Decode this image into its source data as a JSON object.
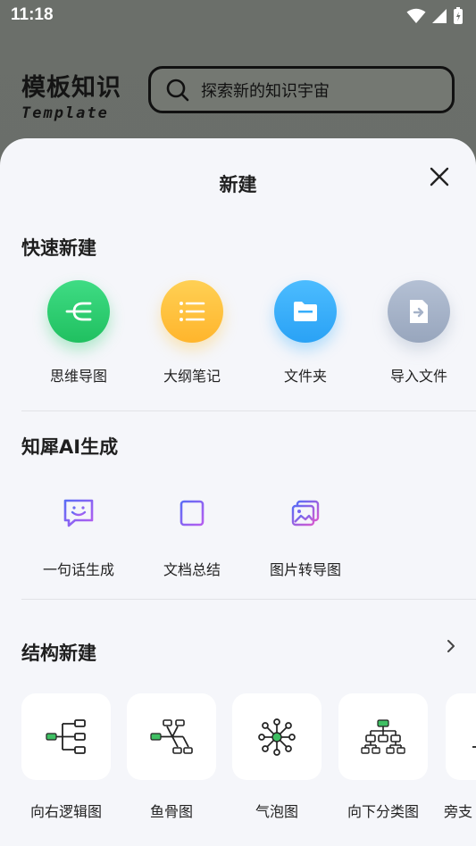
{
  "status": {
    "time": "11:18"
  },
  "background": {
    "logo_cn": "模板知识",
    "logo_en": "Template",
    "search_placeholder": "探索新的知识宇宙"
  },
  "sheet": {
    "title": "新建",
    "quick": {
      "title": "快速新建",
      "items": [
        {
          "label": "思维导图",
          "icon": "mindmap-icon",
          "color": "#2ecf72"
        },
        {
          "label": "大纲笔记",
          "icon": "outline-icon",
          "color": "#ffc23d"
        },
        {
          "label": "文件夹",
          "icon": "folder-icon",
          "color": "#36aefb"
        },
        {
          "label": "导入文件",
          "icon": "import-file-icon",
          "color": "#a5b2c8"
        }
      ]
    },
    "ai": {
      "title": "知犀AI生成",
      "items": [
        {
          "label": "一句话生成",
          "icon": "chat-smile-icon"
        },
        {
          "label": "文档总结",
          "icon": "document-icon"
        },
        {
          "label": "图片转导图",
          "icon": "image-icon"
        }
      ]
    },
    "structure": {
      "title": "结构新建",
      "items": [
        {
          "label": "向右逻辑图",
          "icon": "logic-right-icon"
        },
        {
          "label": "鱼骨图",
          "icon": "fishbone-icon"
        },
        {
          "label": "气泡图",
          "icon": "bubble-icon"
        },
        {
          "label": "向下分类图",
          "icon": "tree-down-icon"
        },
        {
          "label": "旁支",
          "icon": "side-branch-icon"
        }
      ]
    }
  }
}
